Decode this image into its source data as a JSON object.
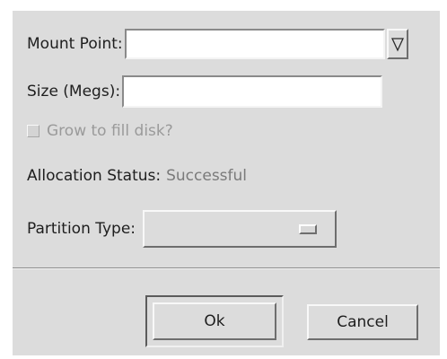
{
  "mount_point": {
    "label": "Mount Point:",
    "value": "",
    "dropdown_icon": "triangle-down-icon"
  },
  "size": {
    "label": "Size (Megs):",
    "value": ""
  },
  "grow": {
    "label": "Grow to fill disk?",
    "checked": false,
    "enabled": false
  },
  "allocation": {
    "label": "Allocation Status:",
    "value": "Successful"
  },
  "partition_type": {
    "label": "Partition Type:",
    "value": ""
  },
  "buttons": {
    "ok_label": "Ok",
    "cancel_label": "Cancel"
  },
  "colors": {
    "dialog_bg": "#dcdcdc",
    "field_bg": "#ffffff",
    "disabled_text": "#9a9a9a",
    "status_text": "#7a7a7a"
  }
}
